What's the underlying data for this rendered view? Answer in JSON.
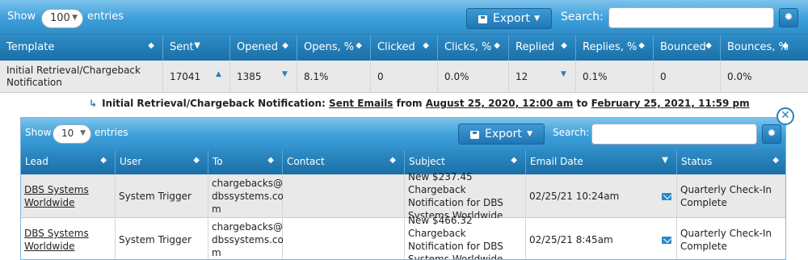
{
  "toolbar": {
    "show_label": "Show",
    "entries_value": "100",
    "entries_label": "entries",
    "export_label": "Export",
    "search_label": "Search:",
    "search_value": ""
  },
  "table": {
    "headers": [
      "Template",
      "Sent",
      "Opened",
      "Opens, %",
      "Clicked",
      "Clicks, %",
      "Replied",
      "Replies, %",
      "Bounced",
      "Bounces, %"
    ],
    "row": {
      "template_line1": "Initial Retrieval/Chargeback",
      "template_line2": "Notification",
      "sent": "17041",
      "opened": "1385",
      "opens_pct": "8.1%",
      "clicked": "0",
      "clicks_pct": "0.0%",
      "replied": "12",
      "replies_pct": "0.1%",
      "bounced": "0",
      "bounces_pct": "0.0%"
    }
  },
  "subtitle": {
    "name": "Initial Retrieval/Chargeback Notification:",
    "link": "Sent Emails",
    "from_word": "from",
    "start": "August 25, 2020, 12:00 am",
    "to_word": "to",
    "end": "February 25, 2021, 11:59 pm"
  },
  "inner": {
    "show_label": "Show",
    "entries_value": "10",
    "entries_label": "entries",
    "export_label": "Export",
    "search_label": "Search:",
    "search_value": "",
    "headers": [
      "Lead",
      "User",
      "To",
      "Contact",
      "Subject",
      "Email Date",
      "Status"
    ],
    "rows": [
      {
        "lead1": "DBS Systems",
        "lead2": "Worldwide",
        "user": "System Trigger",
        "to1": "chargebacks@",
        "to2": "dbssystems.co",
        "to3": "m",
        "contact": "",
        "subj1": "New $237.45 Chargeback",
        "subj2": "Notification for DBS",
        "subj3": "Systems Worldwide",
        "date": "02/25/21 10:24am",
        "status1": "Quarterly Check-In",
        "status2": "Complete"
      },
      {
        "lead1": "DBS Systems",
        "lead2": "Worldwide",
        "user": "System Trigger",
        "to1": "chargebacks@",
        "to2": "dbssystems.co",
        "to3": "m",
        "contact": "",
        "subj1": "New $466.32 Chargeback",
        "subj2": "Notification for DBS",
        "subj3": "Systems Worldwide",
        "date": "02/25/21 8:45am",
        "status1": "Quarterly Check-In",
        "status2": "Complete"
      }
    ]
  },
  "icons": {
    "export": "export-icon",
    "gear": "gear-icon",
    "mail": "mail-icon",
    "close": "close-icon"
  },
  "colors": {
    "header_blue": "#1b6fa8",
    "toolbar_blue": "#3d9fd9",
    "accent": "#2a7fbc"
  }
}
